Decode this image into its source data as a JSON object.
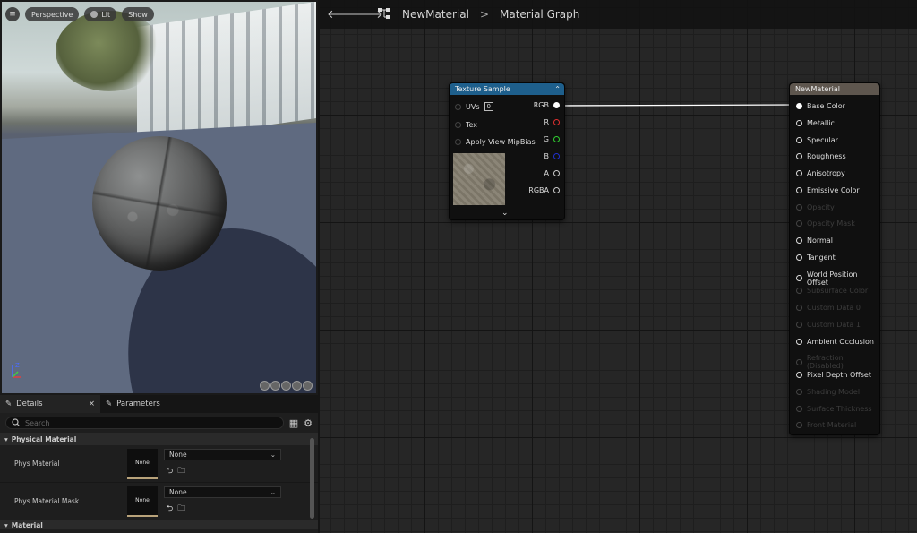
{
  "viewport": {
    "buttons": {
      "perspective": "Perspective",
      "lit": "Lit",
      "show": "Show"
    },
    "menu_icon": "hamburger-icon"
  },
  "details_panel": {
    "tabs": [
      {
        "label": "Details",
        "icon": "pencil-icon",
        "close": "×"
      },
      {
        "label": "Parameters",
        "icon": "pencil-icon"
      }
    ],
    "search_placeholder": "Search",
    "categories": [
      {
        "label": "Physical Material",
        "properties": [
          {
            "name": "Phys Material",
            "thumb": "None",
            "value": "None"
          },
          {
            "name": "Phys Material Mask",
            "thumb": "None",
            "value": "None"
          }
        ]
      },
      {
        "label": "Material"
      }
    ]
  },
  "graph": {
    "breadcrumb": {
      "asset": "NewMaterial",
      "separator": ">",
      "graph": "Material Graph"
    },
    "texture_node": {
      "title": "Texture Sample",
      "title_color": "#1e5f8c",
      "inputs": [
        {
          "label": "UVs",
          "value": "0"
        },
        {
          "label": "Tex"
        },
        {
          "label": "Apply View MipBias"
        }
      ],
      "outputs": [
        {
          "label": "RGB",
          "color": "#ffffff"
        },
        {
          "label": "R",
          "color": "#e03030"
        },
        {
          "label": "G",
          "color": "#30d030"
        },
        {
          "label": "B",
          "color": "#2030d0"
        },
        {
          "label": "A",
          "color": "#cccccc"
        },
        {
          "label": "RGBA",
          "color": "#cccccc"
        }
      ]
    },
    "material_node": {
      "title": "NewMaterial",
      "title_color": "#5e564e",
      "pins": [
        {
          "label": "Base Color",
          "enabled": true,
          "connected": true
        },
        {
          "label": "Metallic",
          "enabled": true
        },
        {
          "label": "Specular",
          "enabled": true
        },
        {
          "label": "Roughness",
          "enabled": true
        },
        {
          "label": "Anisotropy",
          "enabled": true
        },
        {
          "label": "Emissive Color",
          "enabled": true
        },
        {
          "label": "Opacity",
          "enabled": false
        },
        {
          "label": "Opacity Mask",
          "enabled": false
        },
        {
          "label": "Normal",
          "enabled": true
        },
        {
          "label": "Tangent",
          "enabled": true
        },
        {
          "label": "World Position Offset",
          "enabled": true
        },
        {
          "label": "Subsurface Color",
          "enabled": false
        },
        {
          "label": "Custom Data 0",
          "enabled": false
        },
        {
          "label": "Custom Data 1",
          "enabled": false
        },
        {
          "label": "Ambient Occlusion",
          "enabled": true
        },
        {
          "label": "Refraction (Disabled)",
          "enabled": false
        },
        {
          "label": "Pixel Depth Offset",
          "enabled": true
        },
        {
          "label": "Shading Model",
          "enabled": false
        },
        {
          "label": "Surface Thickness",
          "enabled": false
        },
        {
          "label": "Front Material",
          "enabled": false
        }
      ]
    }
  }
}
